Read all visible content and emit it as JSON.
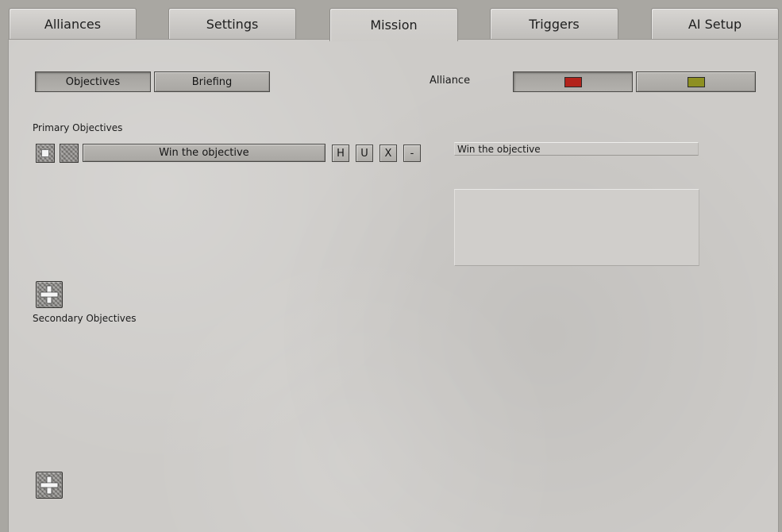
{
  "tabs": [
    {
      "label": "Alliances"
    },
    {
      "label": "Settings"
    },
    {
      "label": "Mission"
    },
    {
      "label": "Triggers"
    },
    {
      "label": "AI Setup"
    }
  ],
  "active_tab": "Mission",
  "subtabs": {
    "objectives": "Objectives",
    "briefing": "Briefing",
    "selected": "Objectives"
  },
  "alliance": {
    "label": "Alliance",
    "colors": [
      "#b3231c",
      "#8e9022"
    ]
  },
  "primary": {
    "heading": "Primary Objectives",
    "objective_label": "Win the objective",
    "buttons": [
      "H",
      "U",
      "X",
      "-"
    ]
  },
  "editor": {
    "title_value": "Win the objective",
    "description_value": ""
  },
  "secondary": {
    "heading": "Secondary Objectives"
  },
  "icons": {
    "add": "plus-icon"
  }
}
